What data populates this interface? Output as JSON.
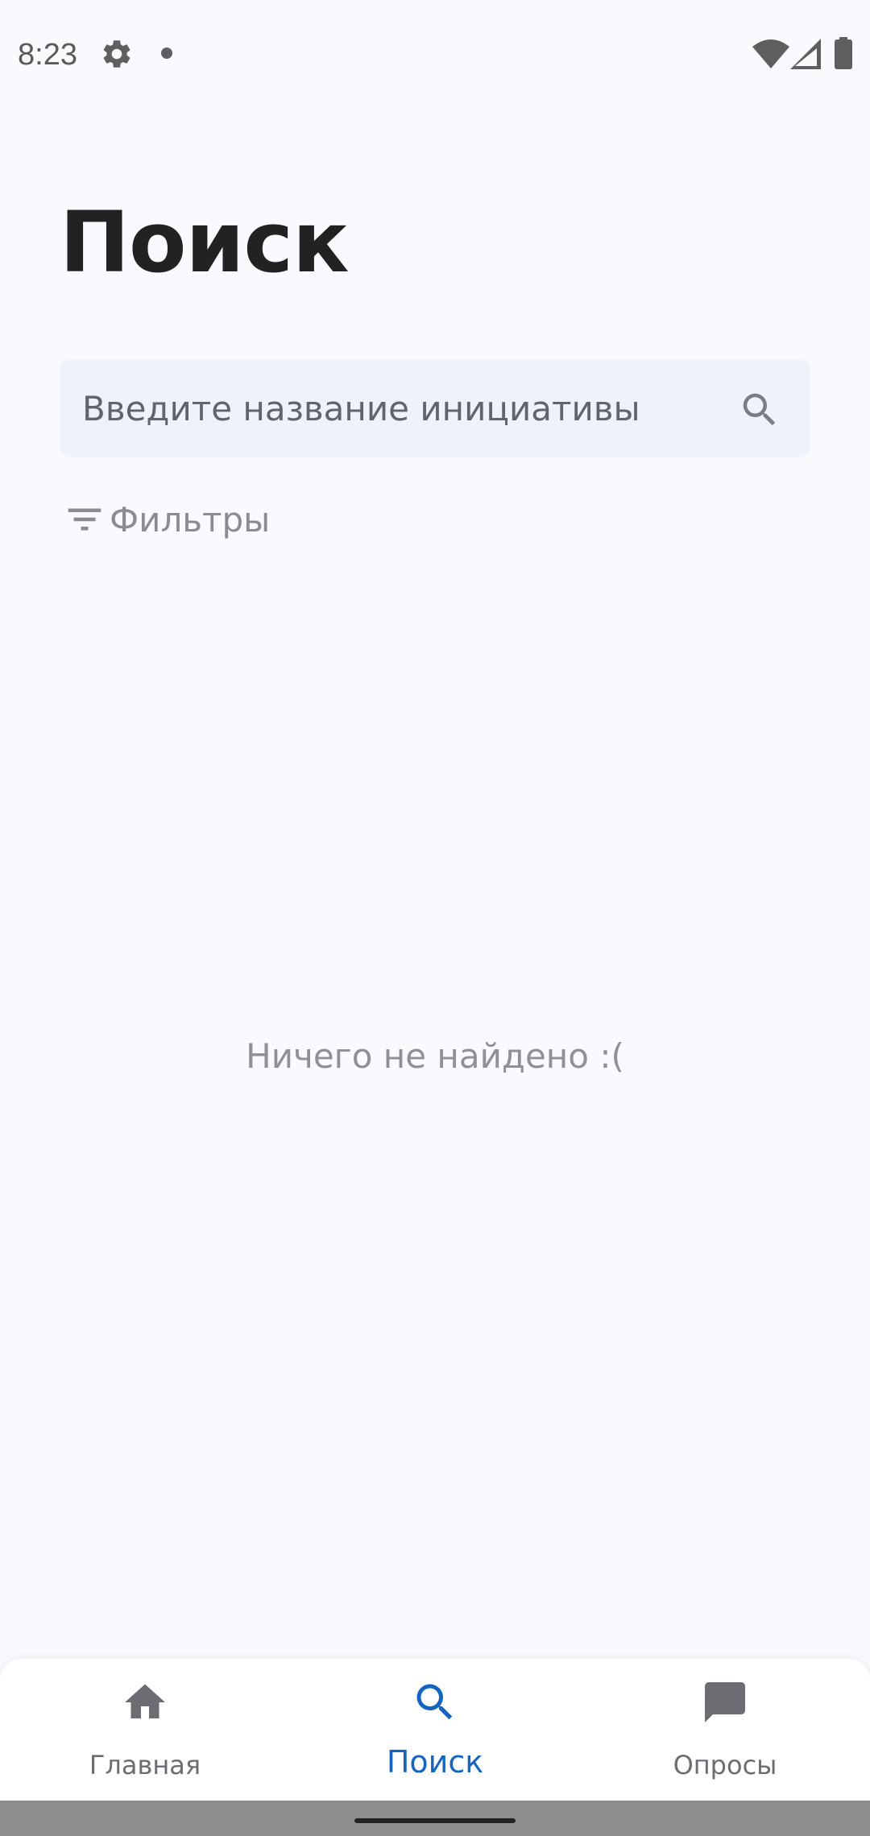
{
  "status_bar": {
    "time": "8:23",
    "icons": [
      "gear-icon",
      "notification-dot-icon",
      "wifi-icon",
      "cell-signal-icon",
      "battery-icon"
    ]
  },
  "page": {
    "title": "Поиск"
  },
  "search": {
    "placeholder": "Введите название инициативы",
    "value": ""
  },
  "filters": {
    "label": "Фильтры",
    "icon": "filter-icon"
  },
  "empty_state": {
    "message": "Ничего не найдено :("
  },
  "bottom_nav": {
    "items": [
      {
        "label": "Главная",
        "icon": "home-icon",
        "active": false
      },
      {
        "label": "Поиск",
        "icon": "search-icon",
        "active": true
      },
      {
        "label": "Опросы",
        "icon": "chat-icon",
        "active": false
      }
    ]
  },
  "colors": {
    "background": "#f9fafe",
    "search_bg": "#eef2fb",
    "accent": "#1565c0",
    "title": "#222222",
    "muted_text": "#8f9198",
    "nav_inactive": "#6b6d72"
  }
}
